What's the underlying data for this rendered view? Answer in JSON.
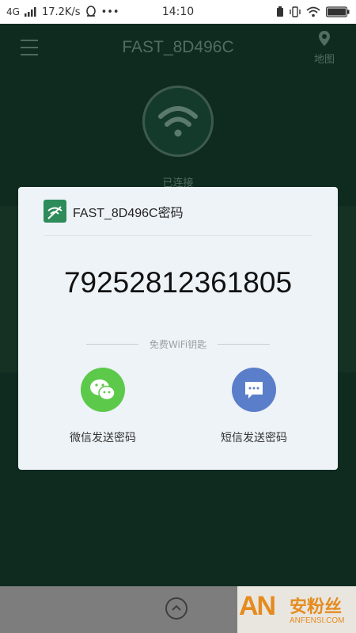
{
  "status_bar": {
    "network": "4G",
    "speed": "17.2K/s",
    "time": "14:10",
    "more": "•••"
  },
  "app_bar": {
    "title": "FAST_8D496C",
    "map_label": "地图"
  },
  "connection": {
    "status": "已连接"
  },
  "dialog": {
    "title": "FAST_8D496C密码",
    "password": "79252812361805",
    "subtitle": "免费WiFi钥匙",
    "share_options": [
      {
        "label": "微信发送密码",
        "icon": "wechat-icon",
        "color": "#5cc94a"
      },
      {
        "label": "短信发送密码",
        "icon": "sms-icon",
        "color": "#5a7ec9"
      }
    ]
  },
  "watermark": {
    "logo": "AN",
    "name_cn": "安粉丝",
    "domain": "ANFENSI.COM"
  },
  "colors": {
    "app_bg": "#0f2b20",
    "dialog_bg": "#eef3f8",
    "accent_green": "#2e8b5a",
    "watermark_orange": "#e58b1e"
  }
}
